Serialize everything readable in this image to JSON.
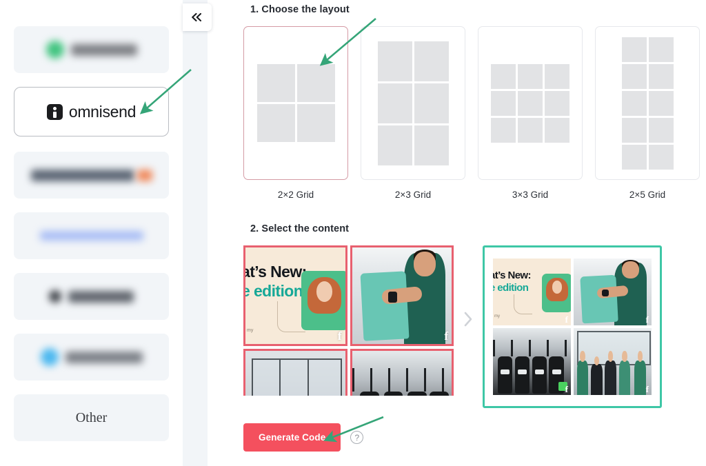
{
  "sidebar": {
    "items": [
      {
        "name": "sidebar-item-1",
        "state": "blurred",
        "accent": "#41c47f",
        "icon": "circle-icon",
        "label": ""
      },
      {
        "name": "sidebar-item-omnisend",
        "state": "selected",
        "label": "omnisend",
        "icon": "omnisend-logo-icon"
      },
      {
        "name": "sidebar-item-3",
        "state": "blurred",
        "accent": "#f08a5d",
        "label": ""
      },
      {
        "name": "sidebar-item-4",
        "state": "blurred",
        "accent": "#8fa9f0",
        "label": ""
      },
      {
        "name": "sidebar-item-5",
        "state": "blurred",
        "accent": "#3b3f45",
        "label": ""
      },
      {
        "name": "sidebar-item-6",
        "state": "blurred",
        "accent": "#4cb8ef",
        "label": ""
      },
      {
        "name": "sidebar-item-other",
        "state": "normal",
        "label": "Other"
      }
    ],
    "collapse_button_icon": "chevron-double-left-icon"
  },
  "main": {
    "step1": {
      "title": "1. Choose the layout",
      "options": [
        {
          "caption": "2×2 Grid",
          "cols": 2,
          "rows": 2,
          "selected": true
        },
        {
          "caption": "2×3 Grid",
          "cols": 2,
          "rows": 3,
          "selected": false
        },
        {
          "caption": "3×3 Grid",
          "cols": 3,
          "rows": 3,
          "selected": false
        },
        {
          "caption": "2×5 Grid",
          "cols": 2,
          "rows": 5,
          "selected": false
        }
      ],
      "selected_border_color": "#d49aa4"
    },
    "step2": {
      "title": "2. Select the content",
      "separator_icon": "chevron-right-icon",
      "source_selected_border_color": "#e8606f",
      "preview_border_color": "#3ec7a6",
      "source_tiles": [
        {
          "name": "content-tile-newsletter",
          "alt_text": "at’s New:",
          "alt_text2": "e edition",
          "small_text": "my",
          "badge": "f",
          "selected": true
        },
        {
          "name": "content-tile-shirt",
          "badge": "f",
          "selected": true
        },
        {
          "name": "content-tile-office",
          "badge": "",
          "selected": true
        },
        {
          "name": "content-tile-gear",
          "badge": "",
          "selected": true
        }
      ],
      "preview_tiles": [
        {
          "name": "preview-tile-newsletter",
          "alt_text": "at’s New:",
          "alt_text2": "e edition",
          "small_text": "my",
          "badge": "f"
        },
        {
          "name": "preview-tile-shirt",
          "badge": "f"
        },
        {
          "name": "preview-tile-bags",
          "badge": "f"
        },
        {
          "name": "preview-tile-team",
          "badge": "f"
        }
      ]
    },
    "generate": {
      "button_label": "Generate Code",
      "button_color": "#f4505e",
      "help_icon": "question-circle-icon",
      "help_glyph": "?"
    }
  },
  "annotations": {
    "arrow_color": "#35a578",
    "arrows": [
      {
        "name": "arrow-to-omnisend",
        "points_to": "sidebar-item-omnisend"
      },
      {
        "name": "arrow-to-layout-2x2",
        "points_to": "layout-card-2x2"
      },
      {
        "name": "arrow-to-generate-code",
        "points_to": "generate-code-button"
      }
    ]
  }
}
